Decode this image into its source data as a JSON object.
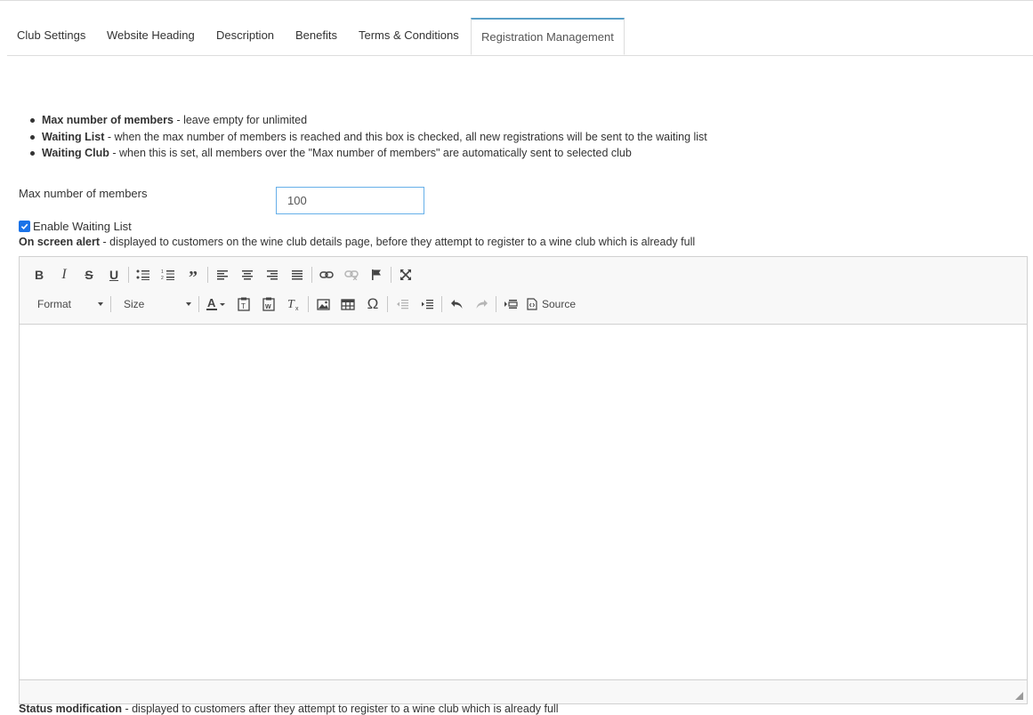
{
  "tabs": [
    {
      "label": "Club Settings"
    },
    {
      "label": "Website Heading"
    },
    {
      "label": "Description"
    },
    {
      "label": "Benefits"
    },
    {
      "label": "Terms & Conditions"
    },
    {
      "label": "Registration Management",
      "active": true
    }
  ],
  "notes": [
    {
      "term": "Max number of members",
      "text": " - leave empty for unlimited"
    },
    {
      "term": "Waiting List",
      "text": " - when the max number of members is reached and this box is checked, all new registrations will be sent to the waiting list"
    },
    {
      "term": "Waiting Club",
      "text": " - when this is set, all members over the \"Max number of members\" are automatically sent to selected club"
    }
  ],
  "max_members": {
    "label": "Max number of members",
    "value": "100"
  },
  "waiting_list": {
    "label": "Enable Waiting List",
    "checked": true
  },
  "alert": {
    "term": "On screen alert",
    "text": " - displayed to customers on the wine club details page, before they attempt to register to a wine club which is already full"
  },
  "editor": {
    "format_label": "Format",
    "size_label": "Size",
    "source_label": "Source",
    "row1_icons": [
      "bold-icon",
      "italic-icon",
      "strikethrough-icon",
      "underline-icon",
      "bulleted-list-icon",
      "numbered-list-icon",
      "blockquote-icon",
      "align-left-icon",
      "align-center-icon",
      "align-right-icon",
      "justify-icon",
      "link-icon",
      "unlink-icon",
      "anchor-flag-icon",
      "maximize-icon"
    ],
    "row2_icons": [
      "text-color-icon",
      "paste-text-icon",
      "paste-word-icon",
      "remove-format-icon",
      "image-icon",
      "table-icon",
      "special-char-icon",
      "outdent-icon",
      "indent-icon",
      "undo-icon",
      "redo-icon",
      "show-blocks-icon",
      "source-icon"
    ]
  },
  "below_editor": {
    "term": "Status modification",
    "text": " - displayed to customers after they attempt to register to a wine club which is already full"
  }
}
